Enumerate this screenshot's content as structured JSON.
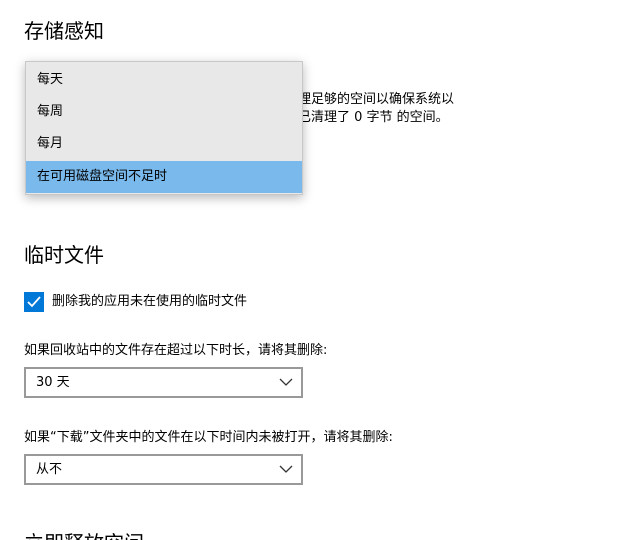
{
  "storage_sense": {
    "title": "存储感知",
    "description_line1": "理足够的空间以确保系统以",
    "description_line2": "已清理了 0 字节 的空间。",
    "frequency_dropdown": {
      "options": [
        "每天",
        "每周",
        "每月",
        "在可用磁盘空间不足时"
      ],
      "selected": "在可用磁盘空间不足时"
    }
  },
  "temp_files": {
    "title": "临时文件",
    "delete_temp_checkbox": {
      "label": "删除我的应用未在使用的临时文件",
      "checked": true
    },
    "recycle_bin": {
      "label": "如果回收站中的文件存在超过以下时长，请将其删除:",
      "value": "30 天"
    },
    "downloads": {
      "label": "如果“下载”文件夹中的文件在以下时间内未被打开，请将其删除:",
      "value": "从不"
    }
  },
  "next_section": {
    "title": "立即释放空间"
  },
  "icons": {
    "checkbox": "checkmark-icon",
    "dropdown": "chevron-down-icon"
  },
  "colors": {
    "accent": "#0078d7",
    "selected_option": "#7ab9ec",
    "popup_bg": "#e8e8e8",
    "select_border": "#999999"
  }
}
